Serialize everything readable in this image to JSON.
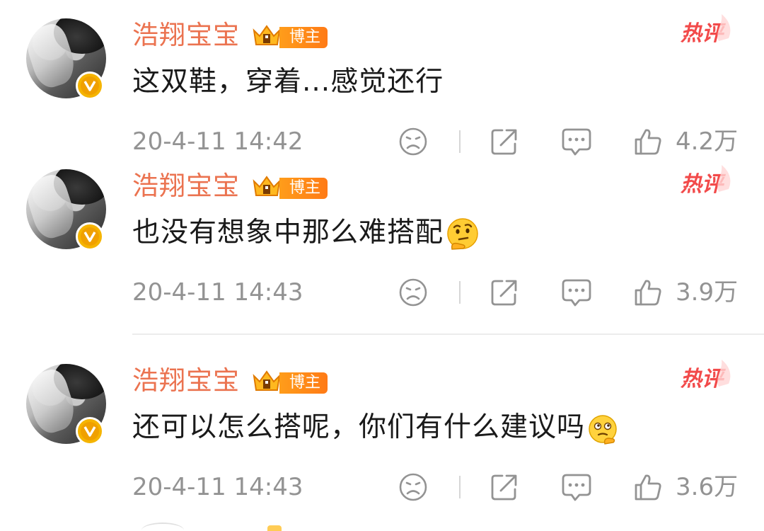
{
  "colors": {
    "username": "#eb7350",
    "role_tag": "#ff8a18",
    "hot_label": "#f24a4a",
    "meta_text": "#939393",
    "content_text": "#1a1a1a",
    "verified_badge": "#f5b400"
  },
  "comments": [
    {
      "username": "浩翔宝宝",
      "role_tag": "博主",
      "hot_label": "热评",
      "content": "这双鞋，穿着...感觉还行",
      "emoji": "",
      "timestamp": "20-4-11 14:42",
      "like_count": "4.2万"
    },
    {
      "username": "浩翔宝宝",
      "role_tag": "博主",
      "hot_label": "热评",
      "content": "也没有想象中那么难搭配",
      "emoji": "thinking-face",
      "timestamp": "20-4-11 14:43",
      "like_count": "3.9万"
    },
    {
      "username": "浩翔宝宝",
      "role_tag": "博主",
      "hot_label": "热评",
      "content": "还可以怎么搭呢，你们有什么建议吗",
      "emoji": "pondering-face",
      "timestamp": "20-4-11 14:43",
      "like_count": "3.6万"
    }
  ],
  "icons": {
    "dislike": "sad-face-icon",
    "share": "share-icon",
    "reply": "comment-icon",
    "like": "thumbs-up-icon",
    "verified": "verified-v-badge-icon",
    "crown": "crown-icon"
  }
}
